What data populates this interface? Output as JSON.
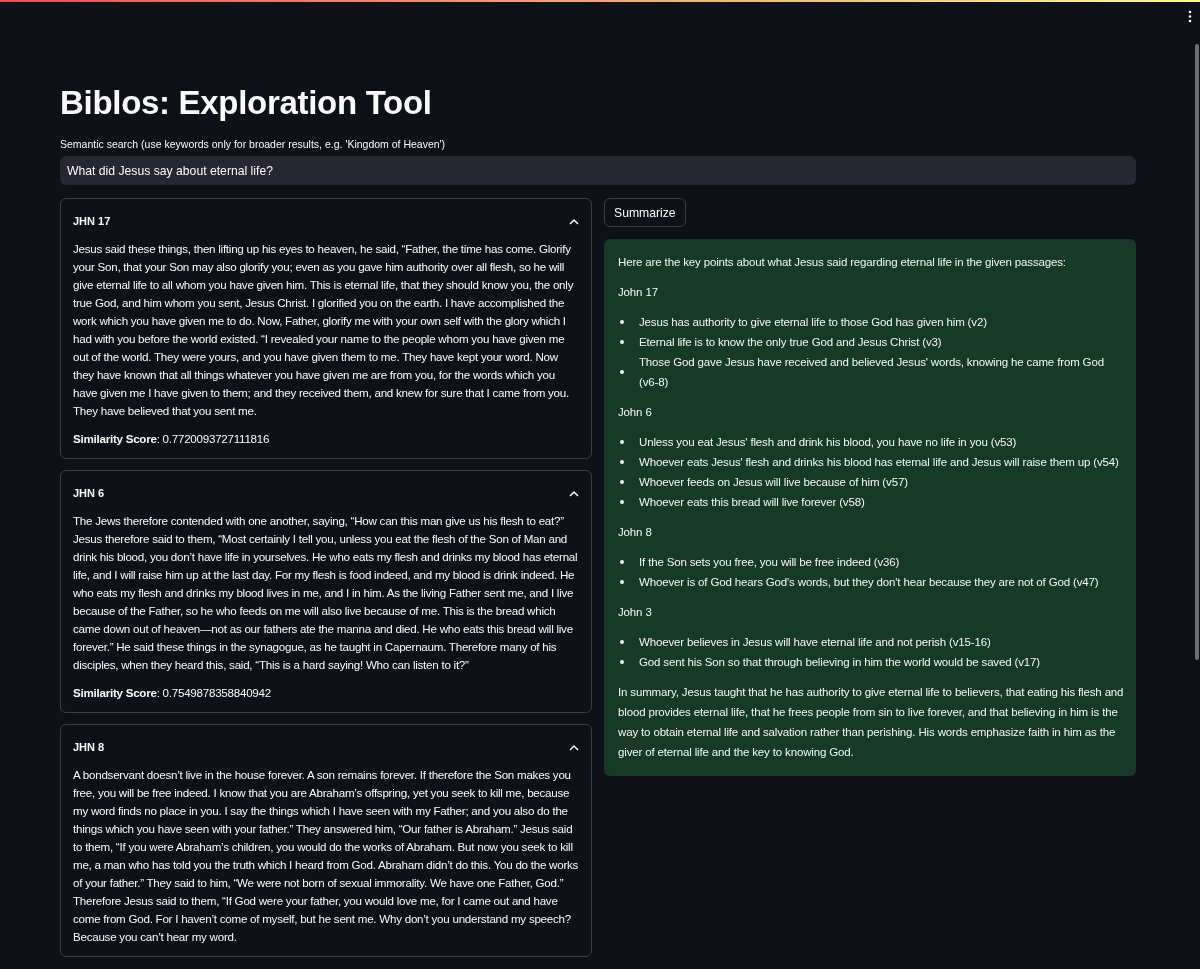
{
  "app": {
    "title": "Biblos: Exploration Tool",
    "search": {
      "label": "Semantic search (use keywords only for broader results, e.g. 'Kingdom of Heaven')",
      "value": "What did Jesus say about eternal life?"
    },
    "results": [
      {
        "heading": "JHN 17",
        "expanded": true,
        "text": "Jesus said these things, then lifting up his eyes to heaven, he said, “Father, the time has come. Glorify your Son, that your Son may also glorify you; even as you gave him authority over all flesh, so he will give eternal life to all whom you have given him. This is eternal life, that they should know you, the only true God, and him whom you sent, Jesus Christ. I glorified you on the earth. I have accomplished the work which you have given me to do. Now, Father, glorify me with your own self with the glory which I had with you before the world existed. “I revealed your name to the people whom you have given me out of the world. They were yours, and you have given them to me. They have kept your word. Now they have known that all things whatever you have given me are from you, for the words which you have given me I have given to them; and they received them, and knew for sure that I came from you. They have believed that you sent me.",
        "score": "**Similarity Score**: 0.7720093727111816"
      },
      {
        "heading": "JHN 6",
        "expanded": true,
        "text": "The Jews therefore contended with one another, saying, “How can this man give us his flesh to eat?” Jesus therefore said to them, “Most certainly I tell you, unless you eat the flesh of the Son of Man and drink his blood, you don’t have life in yourselves. He who eats my flesh and drinks my blood has eternal life, and I will raise him up at the last day. For my flesh is food indeed, and my blood is drink indeed. He who eats my flesh and drinks my blood lives in me, and I in him. As the living Father sent me, and I live because of the Father, so he who feeds on me will also live because of me. This is the bread which came down out of heaven—not as our fathers ate the manna and died. He who eats this bread will live forever.” He said these things in the synagogue, as he taught in Capernaum. Therefore many of his disciples, when they heard this, said, “This is a hard saying! Who can listen to it?”",
        "score": "**Similarity Score**: 0.7549878358840942"
      },
      {
        "heading": "JHN 8",
        "expanded": true,
        "text": "A bondservant doesn’t live in the house forever. A son remains forever. If therefore the Son makes you free, you will be free indeed. I know that you are Abraham’s offspring, yet you seek to kill me, because my word finds no place in you. I say the things which I have seen with my Father; and you also do the things which you have seen with your father.” They answered him, “Our father is Abraham.” Jesus said to them, “If you were Abraham’s children, you would do the works of Abraham. But now you seek to kill me, a man who has told you the truth which I heard from God. Abraham didn’t do this. You do the works of your father.” They said to him, “We were not born of sexual immorality. We have one Father, God.” Therefore Jesus said to them, “If God were your father, you would love me, for I came out and have come from God. For I haven’t come of myself, but he sent me. Why don’t you understand my speech? Because you can’t hear my word."
      }
    ],
    "summarize_button": "Summarize",
    "summary": {
      "intro": "Here are the key points about what Jesus said regarding eternal life in the given passages:",
      "sections": [
        {
          "heading": "John 17",
          "points": [
            "Jesus has authority to give eternal life to those God has given him (v2)",
            "Eternal life is to know the only true God and Jesus Christ (v3)",
            "Those God gave Jesus have received and believed Jesus' words, knowing he came from God (v6-8)"
          ]
        },
        {
          "heading": "John 6",
          "points": [
            "Unless you eat Jesus' flesh and drink his blood, you have no life in you (v53)",
            "Whoever eats Jesus' flesh and drinks his blood has eternal life and Jesus will raise them up (v54)",
            "Whoever feeds on Jesus will live because of him (v57)",
            "Whoever eats this bread will live forever (v58)"
          ]
        },
        {
          "heading": "John 8",
          "points": [
            "If the Son sets you free, you will be free indeed (v36)",
            "Whoever is of God hears God's words, but they don't hear because they are not of God (v47)"
          ]
        },
        {
          "heading": "John 3",
          "points": [
            "Whoever believes in Jesus will have eternal life and not perish (v15-16)",
            "God sent his Son so that through believing in him the world would be saved (v17)"
          ]
        }
      ],
      "conclusion": "In summary, Jesus taught that he has authority to give eternal life to believers, that eating his flesh and blood provides eternal life, that he frees people from sin to live forever, and that believing in him is the way to obtain eternal life and salvation rather than perishing. His words emphasize faith in him as the giver of eternal life and the key to knowing God."
    }
  }
}
